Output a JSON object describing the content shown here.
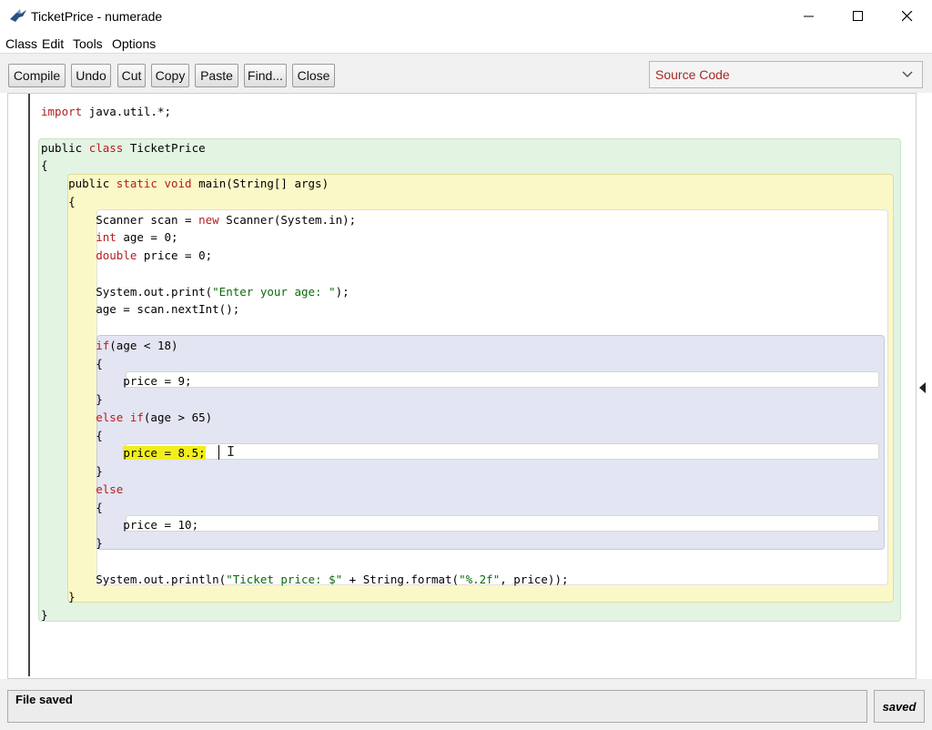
{
  "window": {
    "title": "TicketPrice - numerade"
  },
  "menu": [
    "Class",
    "Edit",
    "Tools",
    "Options"
  ],
  "toolbar": {
    "buttons": [
      "Compile",
      "Undo",
      "Cut",
      "Copy",
      "Paste",
      "Find...",
      "Close"
    ],
    "view_select": "Source Code"
  },
  "code": {
    "lines": [
      {
        "segments": [
          {
            "t": "import",
            "c": "kw"
          },
          {
            "t": " java.util.*;"
          }
        ]
      },
      {
        "segments": [
          {
            "t": ""
          }
        ]
      },
      {
        "segments": [
          {
            "t": "public "
          },
          {
            "t": "class",
            "c": "kw"
          },
          {
            "t": " TicketPrice"
          }
        ]
      },
      {
        "segments": [
          {
            "t": "{"
          }
        ]
      },
      {
        "segments": [
          {
            "t": "    public "
          },
          {
            "t": "static",
            "c": "kw"
          },
          {
            "t": " "
          },
          {
            "t": "void",
            "c": "kw"
          },
          {
            "t": " main(String[] args)"
          }
        ]
      },
      {
        "segments": [
          {
            "t": "    {"
          }
        ]
      },
      {
        "segments": [
          {
            "t": "        Scanner scan = "
          },
          {
            "t": "new",
            "c": "kw"
          },
          {
            "t": " Scanner(System.in);"
          }
        ]
      },
      {
        "segments": [
          {
            "t": "        "
          },
          {
            "t": "int",
            "c": "kw"
          },
          {
            "t": " age = 0;"
          }
        ]
      },
      {
        "segments": [
          {
            "t": "        "
          },
          {
            "t": "double",
            "c": "kw"
          },
          {
            "t": " price = 0;"
          }
        ]
      },
      {
        "segments": [
          {
            "t": ""
          }
        ]
      },
      {
        "segments": [
          {
            "t": "        System.out.print("
          },
          {
            "t": "\"Enter your age: \"",
            "c": "str"
          },
          {
            "t": ");"
          }
        ]
      },
      {
        "segments": [
          {
            "t": "        age = scan.nextInt();"
          }
        ]
      },
      {
        "segments": [
          {
            "t": ""
          }
        ]
      },
      {
        "segments": [
          {
            "t": "        "
          },
          {
            "t": "if",
            "c": "kw"
          },
          {
            "t": "(age < 18)"
          }
        ]
      },
      {
        "segments": [
          {
            "t": "        {"
          }
        ]
      },
      {
        "segments": [
          {
            "t": "            price = 9;"
          }
        ]
      },
      {
        "segments": [
          {
            "t": "        }"
          }
        ]
      },
      {
        "segments": [
          {
            "t": "        "
          },
          {
            "t": "else if",
            "c": "kw"
          },
          {
            "t": "(age > 65)"
          }
        ]
      },
      {
        "segments": [
          {
            "t": "        {"
          }
        ]
      },
      {
        "segments": [
          {
            "t": "            "
          },
          {
            "t": "price = 8.5;",
            "c": "hl"
          }
        ]
      },
      {
        "segments": [
          {
            "t": "        }"
          }
        ]
      },
      {
        "segments": [
          {
            "t": "        "
          },
          {
            "t": "else",
            "c": "kw"
          }
        ]
      },
      {
        "segments": [
          {
            "t": "        {"
          }
        ]
      },
      {
        "segments": [
          {
            "t": "            price = 10;"
          }
        ]
      },
      {
        "segments": [
          {
            "t": "        }"
          }
        ]
      },
      {
        "segments": [
          {
            "t": ""
          }
        ]
      },
      {
        "segments": [
          {
            "t": "        System.out.println("
          },
          {
            "t": "\"Ticket price: $\"",
            "c": "str"
          },
          {
            "t": " + String.format("
          },
          {
            "t": "\"%.2f\"",
            "c": "str"
          },
          {
            "t": ", price));"
          }
        ]
      },
      {
        "segments": [
          {
            "t": "    }"
          }
        ]
      },
      {
        "segments": [
          {
            "t": "}"
          }
        ]
      }
    ]
  },
  "status": {
    "message": "File saved",
    "flag": "saved"
  },
  "colors": {
    "keyword": "#b71c1c",
    "string": "#0b6b0b",
    "highlight": "#f2ee1c"
  }
}
